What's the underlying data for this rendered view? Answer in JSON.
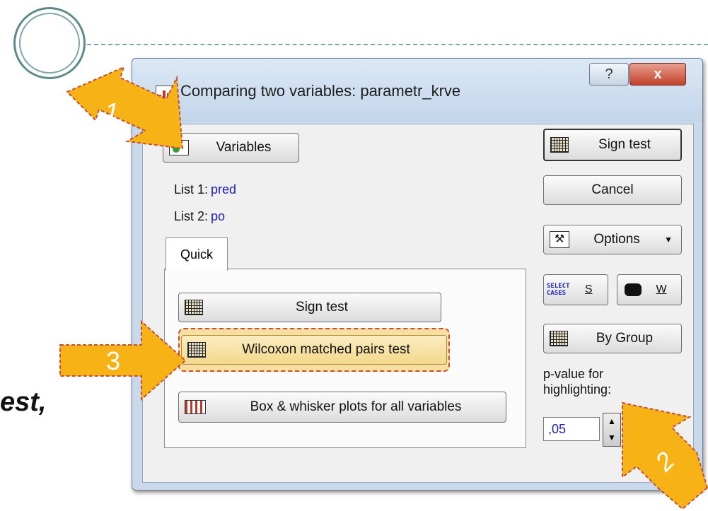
{
  "dialog": {
    "title": "Comparing two variables: parametr_krve",
    "help_label": "?",
    "close_label": "x"
  },
  "variables_button": "Variables",
  "lists": [
    {
      "label": "List 1:",
      "value": "pred"
    },
    {
      "label": "List 2:",
      "value": "po"
    }
  ],
  "tab_label": "Quick",
  "quick_buttons": {
    "sign_test": "Sign test",
    "wilcoxon": "Wilcoxon matched pairs test",
    "box_whisker": "Box & whisker plots for all variables"
  },
  "right_buttons": {
    "sign_test": "Sign test",
    "cancel": "Cancel",
    "options": "Options",
    "select_cases_line1": "SELECT",
    "select_cases_line2": "CASES",
    "select_cases_key": "S",
    "weight_key": "W",
    "by_group": "By Group"
  },
  "pvalue": {
    "label_line1": "p-value for",
    "label_line2": "highlighting:",
    "value": ",05"
  },
  "annotations": {
    "step1": "1",
    "step2": "2",
    "step3": "3"
  },
  "slide_text_fragment": "est,",
  "colors": {
    "arrow_fill": "#f7b316",
    "arrow_border": "#c0503a",
    "list_value": "#1f1fb0",
    "highlight_fill": "#f6dfa0"
  }
}
